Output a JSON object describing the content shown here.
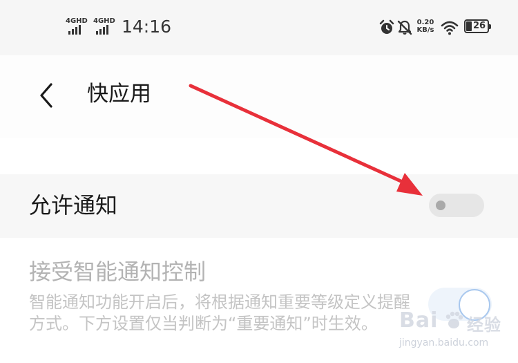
{
  "status_bar": {
    "sim1_network": "4GHD",
    "sim2_network": "4GHD",
    "time": "14:16",
    "net_speed_value": "0.20",
    "net_speed_unit": "KB/s",
    "battery_level": "26",
    "icons": [
      "signal-icon",
      "alarm-icon",
      "mute-bell-icon",
      "wifi-icon",
      "battery-icon"
    ]
  },
  "header": {
    "back_icon": "chevron-left-icon",
    "title": "快应用"
  },
  "settings": {
    "allow_notifications": {
      "label": "允许通知",
      "enabled": false
    },
    "smart_notifications": {
      "label": "接受智能通知控制",
      "description": "智能通知功能开启后，将根据通知重要等级定义提醒方式。下方设置仅当判断为“重要通知”时生效。",
      "enabled": true,
      "disabled": true
    }
  },
  "annotation": {
    "arrow_color": "#e8303a"
  },
  "watermark": {
    "logo_text_left": "Bai",
    "logo_text_right": "经验",
    "site": "jingyan.baidu.com"
  }
}
